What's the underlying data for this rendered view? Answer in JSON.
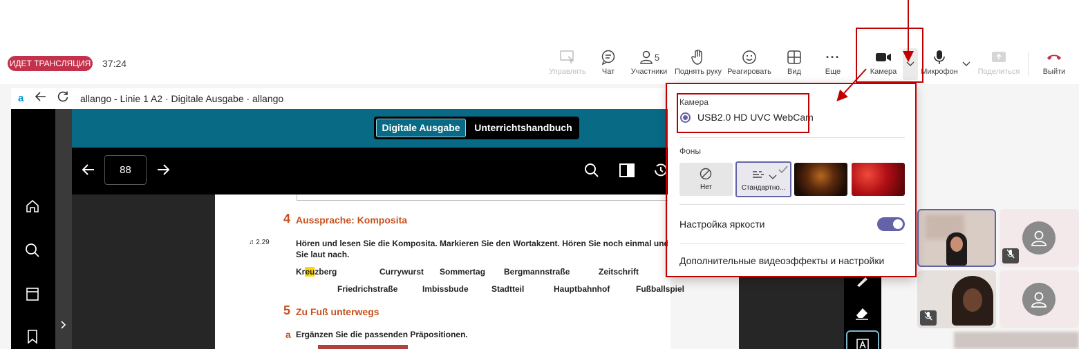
{
  "meeting": {
    "live_badge": "ИДЕТ ТРАНСЛЯЦИЯ",
    "timer": "37:24",
    "participants_count": "5"
  },
  "toolbar": {
    "control": "Управлять",
    "chat": "Чат",
    "participants": "Участники",
    "raise_hand": "Поднять руку",
    "react": "Реагировать",
    "view": "Вид",
    "more": "Еще",
    "camera": "Камера",
    "mic": "Микрофон",
    "share": "Поделиться",
    "leave": "Выйти"
  },
  "browser": {
    "title": "allango - Linie 1 A2 · Digitale Ausgabe · allango",
    "logo": "a"
  },
  "book": {
    "tab_digital": "Digitale Ausgabe",
    "tab_handbook": "Unterrichtshandbuch",
    "page_number": "88",
    "audio_track": "♫ 2.29",
    "section4_num": "4",
    "section4_title": "Aussprache: Komposita",
    "section4_instr_1": "Hören und lesen Sie die Komposita. Markieren Sie den Wortakzent. Hören Sie noch einmal und sp",
    "section4_instr_2": "Sie laut nach.",
    "words_row1_pre": "Kr",
    "words_row1_hl": "eu",
    "words_row1_post": "zberg",
    "words_row1": [
      "Currywurst",
      "Sommertag",
      "Bergmannstraße",
      "Zeitschrift"
    ],
    "words_row2": [
      "Friedrichstraße",
      "Imbissbude",
      "Stadtteil",
      "Hauptbahnhof",
      "Fußballspiel"
    ],
    "section5_num": "5",
    "section5_title": "Zu Fuß unterwegs",
    "section5a_label": "a",
    "section5a_instr": "Ergänzen Sie die passenden Präpositionen."
  },
  "camera_popover": {
    "camera_heading": "Камера",
    "camera_device": "USB2.0 HD UVC WebCam",
    "backgrounds_heading": "Фоны",
    "bg_none": "Нет",
    "bg_standard": "Стандартно...",
    "brightness": "Настройка яркости",
    "more_effects": "Дополнительные видеоэффекты и настройки",
    "brightness_on": true
  },
  "colors": {
    "live_red": "#c4314b",
    "accent": "#6264a7",
    "book_teal": "#086a85",
    "heading_orange": "#c8501e",
    "annotation_red": "#c00000"
  }
}
